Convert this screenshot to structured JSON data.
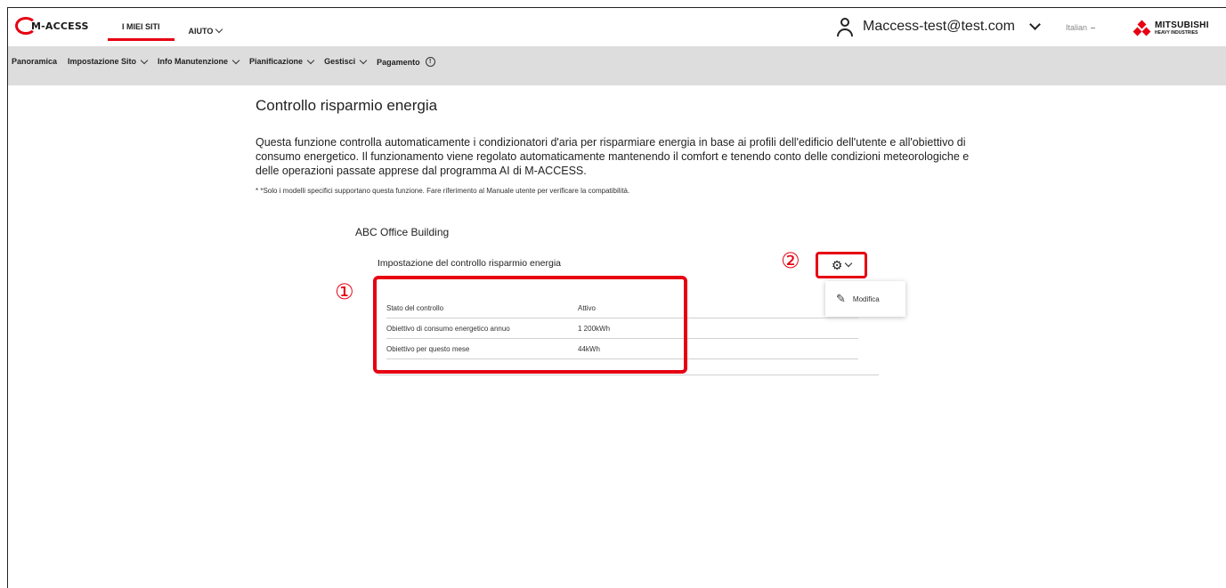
{
  "header": {
    "logo_text": "M-ACCESS",
    "nav": [
      {
        "label": "I MIEI SITI",
        "active": true
      },
      {
        "label": "AIUTO",
        "active": false,
        "dropdown": true
      }
    ],
    "user_email": "Maccess-test@test.com",
    "language": "Italian",
    "brand_name": "MITSUBISHI",
    "brand_sub": "HEAVY INDUSTRIES"
  },
  "subnav": [
    {
      "label": "Panoramica",
      "dropdown": false
    },
    {
      "label": "Impostazione Sito",
      "dropdown": true
    },
    {
      "label": "Info Manutenzione",
      "dropdown": true
    },
    {
      "label": "Pianificazione",
      "dropdown": true
    },
    {
      "label": "Gestisci",
      "dropdown": true
    },
    {
      "label": "Pagamento",
      "dropdown": false,
      "info_icon": true
    }
  ],
  "main": {
    "title": "Controllo risparmio energia",
    "description": "Questa funzione controlla automaticamente i condizionatori d'aria per risparmiare energia in base ai profili dell'edificio dell'utente e all'obiettivo di consumo energetico. Il funzionamento viene regolato automaticamente mantenendo il comfort e tenendo conto delle condizioni meteorologiche e delle operazioni passate apprese dal programma AI di M-ACCESS.",
    "note": "* *Solo i modelli specifici supportano questa funzione. Fare riferimento al Manuale utente per verificare la compatibilità.",
    "building_name": "ABC Office Building",
    "settings_title": "Impostazione del controllo risparmio energia",
    "rows": [
      {
        "label": "Stato del controllo",
        "value": "Attivo"
      },
      {
        "label": "Obiettivo di consumo energetico annuo",
        "value": "1 200kWh"
      },
      {
        "label": "Obiettivo per questo mese",
        "value": "44kWh"
      }
    ],
    "settings_menu": {
      "edit_label": "Modifica"
    }
  },
  "callouts": {
    "one": "①",
    "two": "②"
  },
  "colors": {
    "accent": "#e60012",
    "subnav_bg": "#dddddd"
  },
  "icons": {
    "user": "user-icon",
    "settings": "gear-icon",
    "edit": "edit-icon",
    "info": "info-icon"
  }
}
